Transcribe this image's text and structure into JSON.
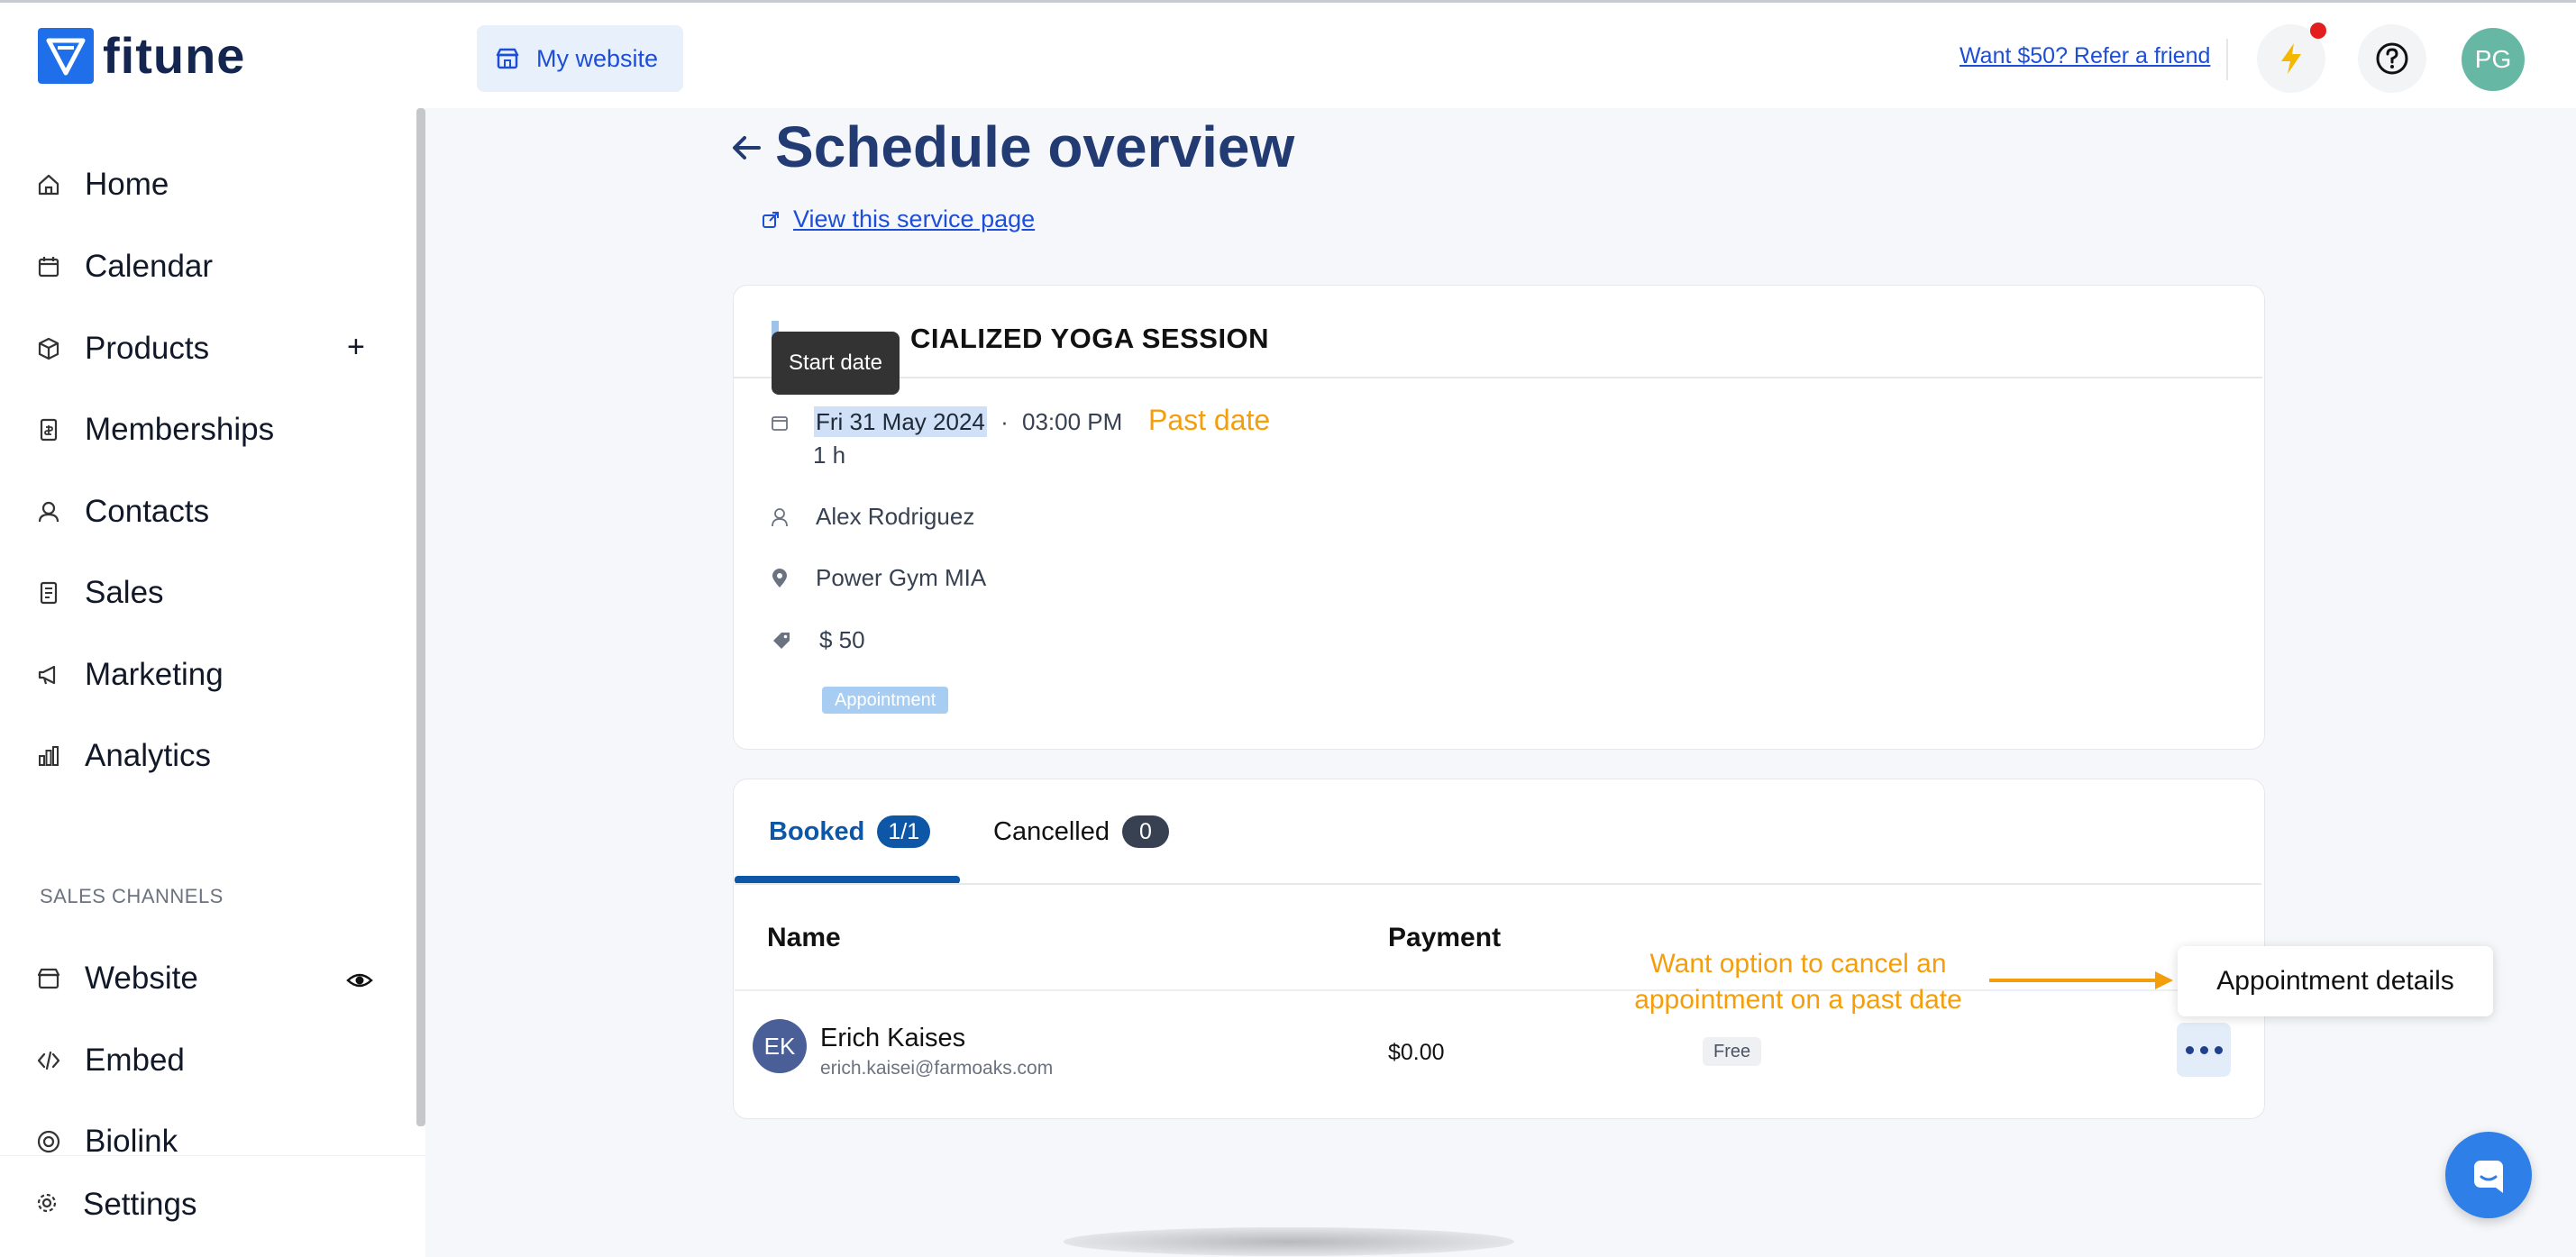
{
  "topbar": {
    "brand": "fitune",
    "site_button": "My website",
    "refer_link": "Want $50? Refer a friend",
    "avatar_initials": "PG"
  },
  "sidebar": {
    "items": [
      {
        "label": "Home",
        "icon": "home-icon"
      },
      {
        "label": "Calendar",
        "icon": "calendar-icon"
      },
      {
        "label": "Products",
        "icon": "box-icon"
      },
      {
        "label": "Memberships",
        "icon": "membership-icon"
      },
      {
        "label": "Contacts",
        "icon": "contacts-icon"
      },
      {
        "label": "Sales",
        "icon": "receipt-icon"
      },
      {
        "label": "Marketing",
        "icon": "megaphone-icon"
      },
      {
        "label": "Analytics",
        "icon": "analytics-icon"
      }
    ],
    "section_label": "SALES CHANNELS",
    "channels": [
      {
        "label": "Website",
        "icon": "store-icon"
      },
      {
        "label": "Embed",
        "icon": "code-icon"
      },
      {
        "label": "Biolink",
        "icon": "biolink-icon"
      }
    ],
    "settings": "Settings"
  },
  "header": {
    "title": "Schedule overview",
    "view_link": "View this service page"
  },
  "service": {
    "title_visible": "CIALIZED YOGA SESSION",
    "tooltip": "Start date",
    "date": "Fri 31 May 2024",
    "separator": "·",
    "time": "03:00 PM",
    "duration": "1 h",
    "instructor": "Alex Rodriguez",
    "location": "Power Gym MIA",
    "price": "$ 50",
    "type_tag": "Appointment",
    "past_date_note": "Past date"
  },
  "bookings": {
    "tabs": [
      {
        "label": "Booked",
        "count": "1/1"
      },
      {
        "label": "Cancelled",
        "count": "0"
      }
    ],
    "columns": [
      "Name",
      "Payment"
    ],
    "rows": [
      {
        "initials": "EK",
        "name": "Erich Kaises",
        "email": "erich.kaisei@farmoaks.com",
        "payment": "$0.00",
        "badge": "Free"
      }
    ]
  },
  "annotations": {
    "cancel_note": "Want option to cancel an appointment on a past date",
    "menu_item": "Appointment details"
  },
  "colors": {
    "brand": "#1f6feb",
    "title": "#233b73",
    "link": "#1d4ed8",
    "annotation": "#f59e0b",
    "active_tab": "#0d57a6"
  }
}
